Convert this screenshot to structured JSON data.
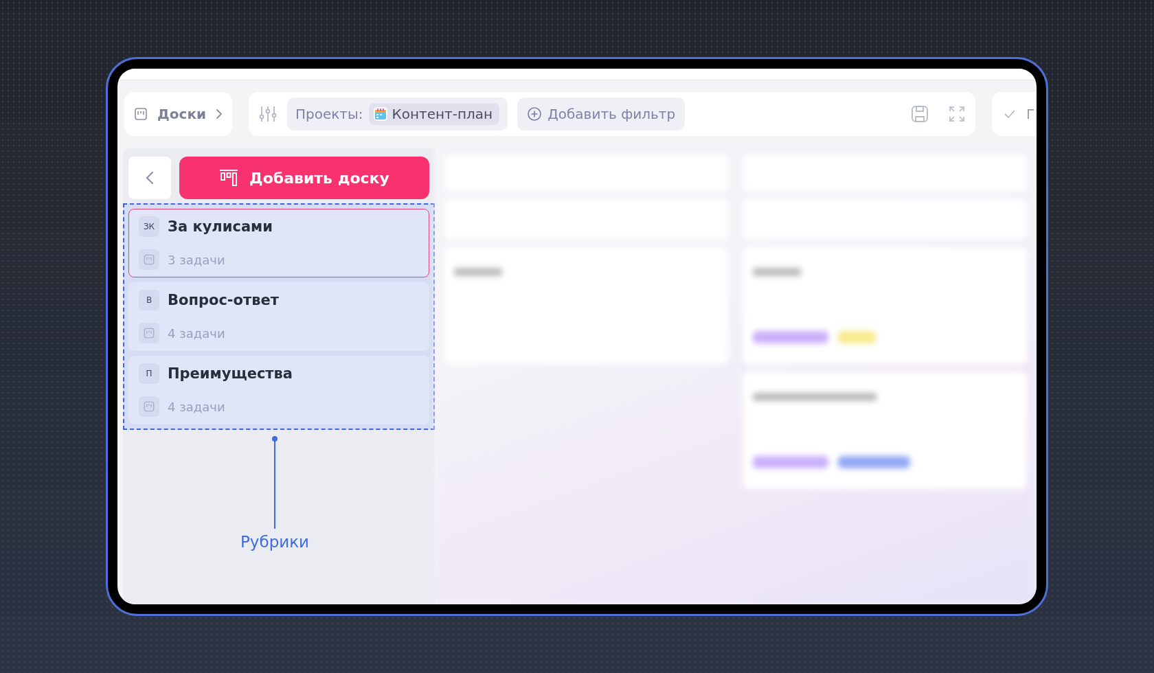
{
  "toolbar": {
    "boards_button": "Доски",
    "projects_label": "Проекты:",
    "project_chip": "Контент-план",
    "add_filter": "Добавить фильтр",
    "cut_button": "Г"
  },
  "sidebar": {
    "add_board": "Добавить доску",
    "boards": [
      {
        "initials": "ЗК",
        "name": "За кулисами",
        "count": "3 задачи",
        "selected": true
      },
      {
        "initials": "В",
        "name": "Вопрос-ответ",
        "count": "4 задачи",
        "selected": false
      },
      {
        "initials": "П",
        "name": "Преимущества",
        "count": "4 задачи",
        "selected": false
      }
    ]
  },
  "annotation": {
    "label": "Рубрики"
  }
}
